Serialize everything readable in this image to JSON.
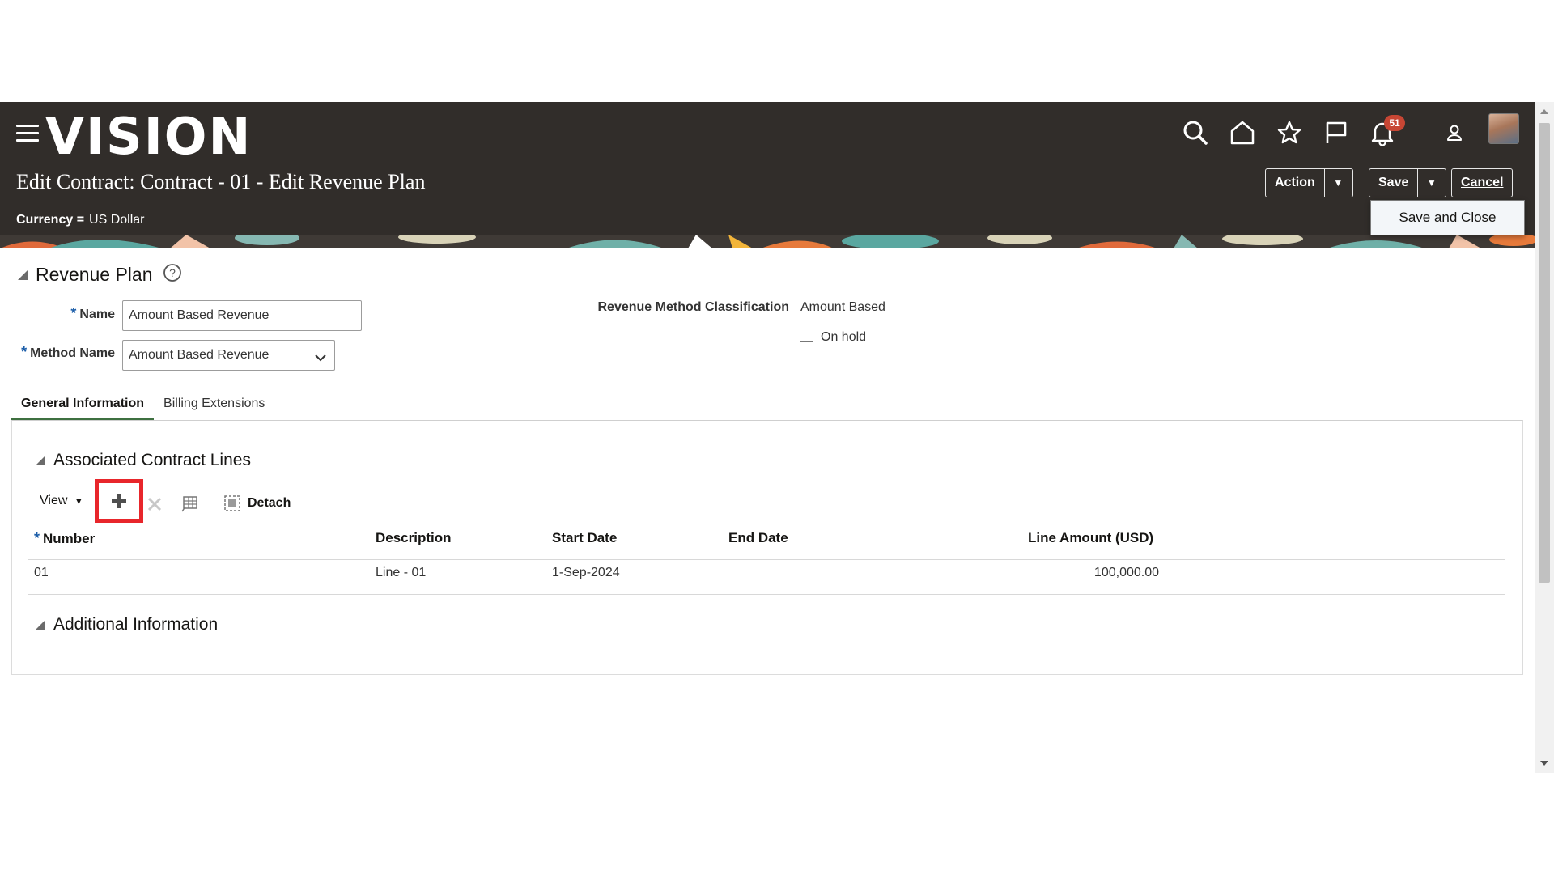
{
  "header": {
    "logo": "VISION",
    "title": "Edit Contract: Contract - 01 - Edit Revenue Plan",
    "currency_label": "Currency =",
    "currency_value": "US Dollar",
    "notification_count": "51",
    "buttons": {
      "action": "Action",
      "save": "Save",
      "cancel": "Cancel"
    },
    "save_menu_item": "Save and Close"
  },
  "revenue_plan": {
    "section_title": "Revenue Plan",
    "name_label": "Name",
    "name_value": "Amount Based Revenue",
    "method_label": "Method Name",
    "method_value": "Amount Based Revenue",
    "classification_label": "Revenue Method Classification",
    "classification_value": "Amount Based",
    "on_hold_label": "On hold"
  },
  "tabs": [
    {
      "label": "General Information",
      "active": true
    },
    {
      "label": "Billing Extensions",
      "active": false
    }
  ],
  "contract_lines": {
    "section_title": "Associated Contract Lines",
    "view_label": "View",
    "detach_label": "Detach",
    "columns": [
      "Number",
      "Description",
      "Start Date",
      "End Date",
      "Line Amount (USD)"
    ],
    "rows": [
      {
        "number": "01",
        "description": "Line - 01",
        "start_date": "1-Sep-2024",
        "end_date": "",
        "amount": "100,000.00"
      }
    ]
  },
  "additional_info": {
    "section_title": "Additional Information"
  },
  "colors": {
    "header_bg": "#312d2a",
    "highlight": "#e8262b",
    "chat": "#d73f34",
    "active_tab": "#3e7040"
  }
}
